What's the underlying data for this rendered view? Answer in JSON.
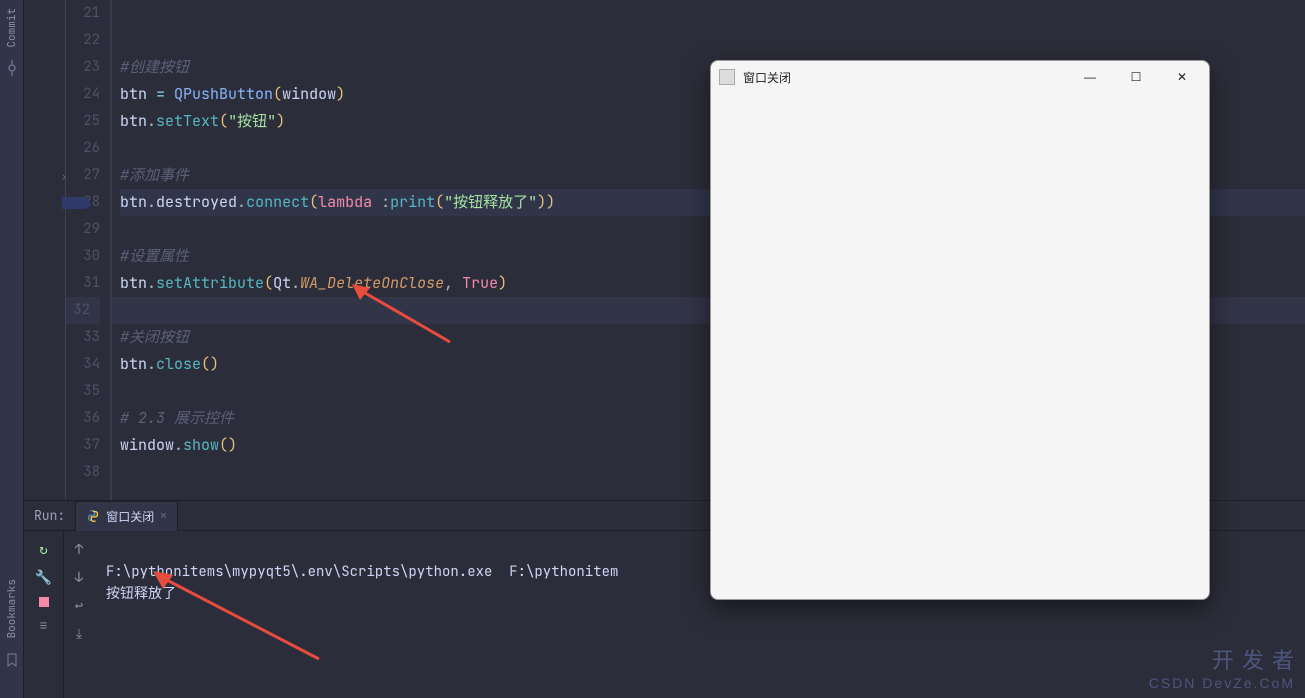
{
  "sidebar": {
    "tab_commit": "Commit",
    "tab_bookmarks": "Bookmarks"
  },
  "gutter": {
    "start": 21,
    "end": 38,
    "highlighted": 32,
    "breakpoint": 28
  },
  "code": {
    "l21": "",
    "l22": "",
    "l23": "#创建按钮",
    "l24_var": "btn",
    "l24_op": " = ",
    "l24_class": "QPushButton",
    "l24_arg": "window",
    "l25_method": "setText",
    "l25_str": "\"按钮\"",
    "l26": "",
    "l27": "#添加事件",
    "l28_attr": "destroyed",
    "l28_connect": "connect",
    "l28_lambda": "lambda ",
    "l28_colon": ":",
    "l28_print": "print",
    "l28_str": "\"按钮释放了\"",
    "l29": "",
    "l30": "#设置属性",
    "l31_method": "setAttribute",
    "l31_qt": "Qt",
    "l31_attr": "WA_DeleteOnClose",
    "l31_true": "True",
    "l32": "",
    "l33": "#关闭按钮",
    "l34_method": "close",
    "l35": "",
    "l36_a": "# 2.3 ",
    "l36_b": "展示控件",
    "l37_var": "window",
    "l37_method": "show",
    "l38": ""
  },
  "run": {
    "label": "Run:",
    "tab_name": "窗口关闭",
    "console_line1": "F:\\pythonitems\\mypyqt5\\.env\\Scripts\\python.exe  F:\\pythonitem",
    "console_line2": "按钮释放了"
  },
  "qt": {
    "title": "窗口关闭"
  },
  "watermark": {
    "cn": "开 发 者",
    "en": "CSDN DevZe.CoM"
  }
}
